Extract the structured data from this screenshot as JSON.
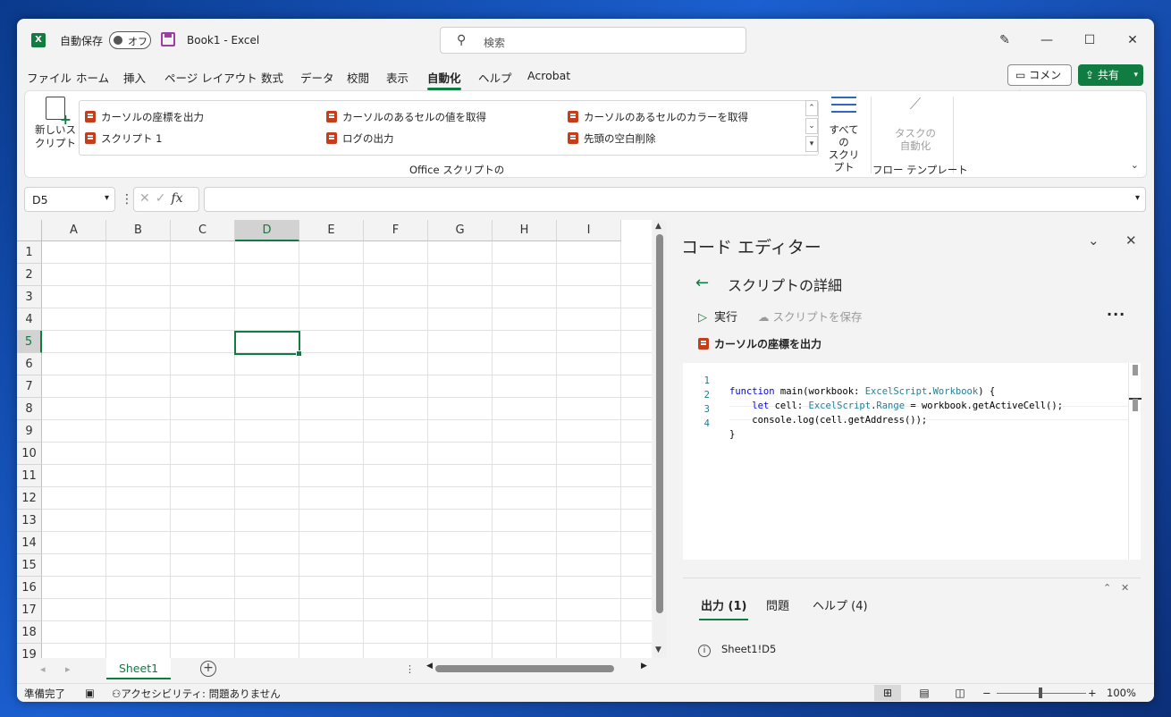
{
  "titlebar": {
    "app_icon": "excel-logo-icon",
    "autosave_label": "自動保存",
    "autosave_state": "オフ",
    "doc_title": "Book1  -  Excel",
    "search_placeholder": "検索"
  },
  "menu": {
    "tabs": [
      "ファイル",
      "ホーム",
      "挿入",
      "ページ レイアウト",
      "数式",
      "データ",
      "校閲",
      "表示",
      "自動化",
      "ヘルプ",
      "Acrobat"
    ],
    "active_tab": "自動化",
    "comment_label": "コメント",
    "share_label": "共有"
  },
  "ribbon": {
    "new_script_label": "新しいス\nクリプト",
    "scripts": [
      "カーソルの座標を出力",
      "スクリプト 1",
      "カーソルのあるセルの値を取得",
      "ログの出力",
      "カーソルのあるセルのカラーを取得",
      "先頭の空白削除"
    ],
    "all_scripts_label": "すべての\nスクリプト",
    "task_automation_label": "タスクの\n自動化",
    "group_office_scripts": "Office スクリプトの",
    "group_flow_templates": "フロー テンプレート"
  },
  "formula_bar": {
    "name_box": "D5",
    "fx_label": "fx",
    "formula": ""
  },
  "grid": {
    "columns": [
      "A",
      "B",
      "C",
      "D",
      "E",
      "F",
      "G",
      "H",
      "I"
    ],
    "rows": [
      "1",
      "2",
      "3",
      "4",
      "5",
      "6",
      "7",
      "8",
      "9",
      "10",
      "11",
      "12",
      "13",
      "14",
      "15",
      "16",
      "17",
      "18",
      "19"
    ],
    "selected_col": "D",
    "selected_row": "5"
  },
  "sheets": {
    "tabs": [
      "Sheet1"
    ],
    "active": "Sheet1"
  },
  "editor": {
    "title": "コード エディター",
    "heading": "スクリプトの詳細",
    "run_label": "実行",
    "save_label": "スクリプトを保存",
    "script_name": "カーソルの座標を出力",
    "code_lines": [
      {
        "n": "1",
        "text": "function main(workbook: ExcelScript.Workbook) {"
      },
      {
        "n": "2",
        "text": "    let cell: ExcelScript.Range = workbook.getActiveCell();"
      },
      {
        "n": "3",
        "text": "    console.log(cell.getAddress());"
      },
      {
        "n": "4",
        "text": "}"
      }
    ],
    "output_tabs": [
      {
        "label": "出力 (1)",
        "active": true
      },
      {
        "label": "問題",
        "active": false
      },
      {
        "label": "ヘルプ (4)",
        "active": false
      }
    ],
    "output_line": "Sheet1!D5"
  },
  "statusbar": {
    "ready": "準備完了",
    "accessibility": "アクセシビリティ: 問題ありません",
    "zoom": "100%",
    "zoom_level": 100
  },
  "colors": {
    "accent": "#107c41",
    "script_icon": "#c43e1c"
  }
}
